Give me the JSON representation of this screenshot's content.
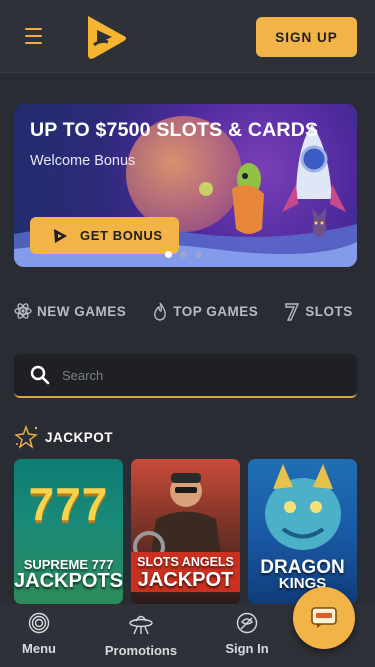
{
  "header": {
    "menu_icon": "hamburger-icon",
    "logo_icon": "play-logo-icon",
    "signup_label": "SIGN UP",
    "accent_color": "#f2b447"
  },
  "banner": {
    "title": "UP TO $7500 SLOTS & CARDS",
    "subtitle": "Welcome Bonus",
    "button_label": "GET BONUS",
    "slides": 3,
    "active_slide": 1
  },
  "tabs": [
    {
      "label": "NEW GAMES",
      "icon": "atom-icon"
    },
    {
      "label": "TOP GAMES",
      "icon": "fire-icon"
    },
    {
      "label": "SLOTS",
      "icon": "seven-icon"
    }
  ],
  "search": {
    "placeholder": "Search",
    "value": ""
  },
  "jackpot": {
    "title": "JACKPOT",
    "games": [
      {
        "art_text": "777",
        "line1": "SUPREME 777",
        "line2": "JACKPOTS"
      },
      {
        "line1": "SLOTS ANGELS",
        "line2": "JACKPOT"
      },
      {
        "line1": "DRAGON",
        "line2": "KINGS"
      }
    ]
  },
  "bottom_nav": [
    {
      "label": "Menu",
      "icon": "spiral-icon"
    },
    {
      "label": "Promotions",
      "icon": "ufo-icon"
    },
    {
      "label": "Sign In",
      "icon": "astronaut-icon"
    }
  ],
  "fab": {
    "icon": "chat-icon"
  }
}
